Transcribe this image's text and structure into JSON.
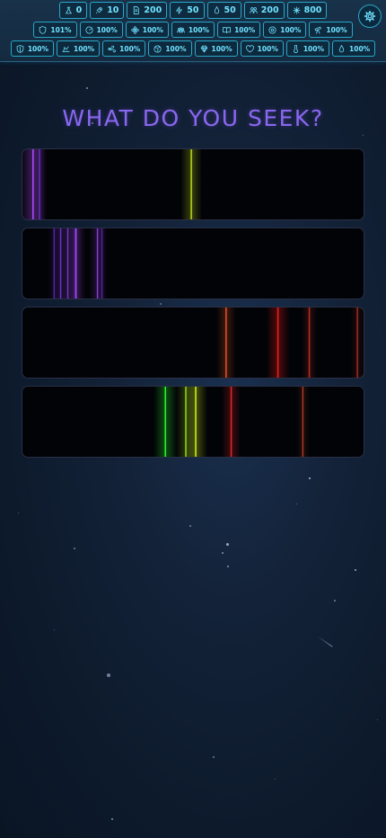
{
  "resources": [
    {
      "icon": "flask-icon",
      "value": "0"
    },
    {
      "icon": "rocket-icon",
      "value": "10"
    },
    {
      "icon": "document-icon",
      "value": "200"
    },
    {
      "icon": "lightning-icon",
      "value": "50"
    },
    {
      "icon": "drop-icon",
      "value": "50"
    },
    {
      "icon": "people-icon",
      "value": "200"
    },
    {
      "icon": "snowflake-icon",
      "value": "800"
    }
  ],
  "modifiers_row1": [
    {
      "icon": "shield-icon",
      "value": "101%"
    },
    {
      "icon": "gauge-icon",
      "value": "100%"
    },
    {
      "icon": "atom-icon",
      "value": "100%"
    },
    {
      "icon": "crowd-icon",
      "value": "100%"
    },
    {
      "icon": "book-icon",
      "value": "100%"
    },
    {
      "icon": "orbit-icon",
      "value": "100%"
    },
    {
      "icon": "telescope-icon",
      "value": "100%"
    }
  ],
  "modifiers_row2": [
    {
      "icon": "badge-shield-icon",
      "value": "100%"
    },
    {
      "icon": "speed-icon",
      "value": "100%"
    },
    {
      "icon": "wind-icon",
      "value": "100%"
    },
    {
      "icon": "globe-icon",
      "value": "100%"
    },
    {
      "icon": "gem-icon",
      "value": "100%"
    },
    {
      "icon": "heart-icon",
      "value": "100%"
    },
    {
      "icon": "thermometer-icon",
      "value": "100%"
    },
    {
      "icon": "droplet-icon",
      "value": "100%"
    }
  ],
  "settings_icon": "gear-icon",
  "heading": "WHAT DO YOU SEEK?",
  "spectra": [
    {
      "lines": [
        {
          "pos": 0.031,
          "color": "#b04cff",
          "glow": 1.0
        },
        {
          "pos": 0.05,
          "color": "#7a36d8",
          "glow": 0.5
        },
        {
          "pos": 0.495,
          "color": "#c9e81a",
          "glow": 0.8
        }
      ]
    },
    {
      "lines": [
        {
          "pos": 0.093,
          "color": "#6a2fc8",
          "glow": 0.4
        },
        {
          "pos": 0.112,
          "color": "#7d3ae0",
          "glow": 0.6
        },
        {
          "pos": 0.133,
          "color": "#8b3fe6",
          "glow": 0.5
        },
        {
          "pos": 0.155,
          "color": "#6a2fc8",
          "glow": 0.4
        },
        {
          "pos": 0.157,
          "color": "#b04cff",
          "glow": 0.7
        },
        {
          "pos": 0.22,
          "color": "#9a45f0",
          "glow": 0.6
        },
        {
          "pos": 0.233,
          "color": "#6a2fc8",
          "glow": 0.3
        }
      ]
    },
    {
      "lines": [
        {
          "pos": 0.597,
          "color": "#ff5a2a",
          "glow": 0.7
        },
        {
          "pos": 0.749,
          "color": "#ff1c1c",
          "glow": 0.9
        },
        {
          "pos": 0.841,
          "color": "#e6382a",
          "glow": 0.5
        },
        {
          "pos": 0.982,
          "color": "#d13a2a",
          "glow": 0.4
        }
      ]
    },
    {
      "lines": [
        {
          "pos": 0.419,
          "color": "#2aff2a",
          "glow": 0.9
        },
        {
          "pos": 0.479,
          "color": "#a4e81a",
          "glow": 0.7
        },
        {
          "pos": 0.508,
          "color": "#d8ff1a",
          "glow": 0.9
        },
        {
          "pos": 0.612,
          "color": "#ff2a2a",
          "glow": 0.7
        },
        {
          "pos": 0.822,
          "color": "#e04a2a",
          "glow": 0.4
        }
      ]
    }
  ]
}
